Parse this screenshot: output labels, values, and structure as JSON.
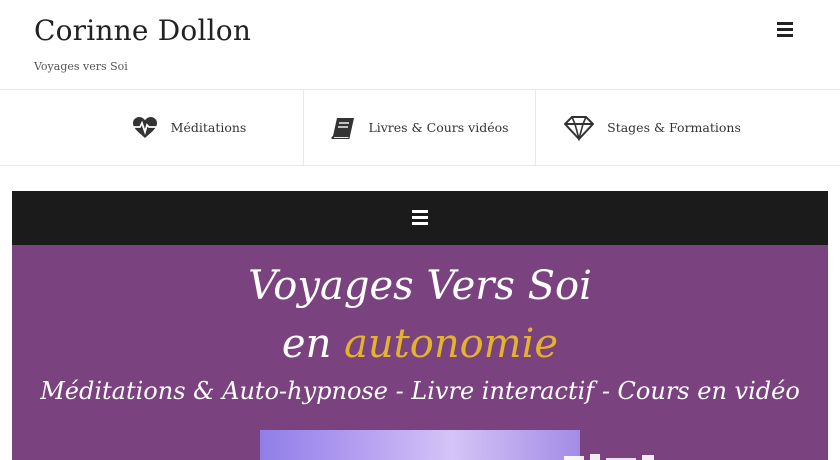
{
  "site": {
    "title": "Corinne Dollon",
    "tagline": "Voyages vers Soi"
  },
  "features": [
    {
      "label": "Méditations",
      "icon": "heartbeat-icon"
    },
    {
      "label": "Livres & Cours vidéos",
      "icon": "book-icon"
    },
    {
      "label": "Stages & Formations",
      "icon": "diamond-icon"
    }
  ],
  "banner": {
    "line1": "Voyages Vers Soi",
    "line2_prefix": "en",
    "line2_accent": "autonomie",
    "line3": "Méditations & Auto-hypnose - Livre interactif  - Cours en vidéo"
  },
  "colors": {
    "nav": "#1b1b1b",
    "banner": "#7b4280",
    "accent": "#e3b32a"
  }
}
